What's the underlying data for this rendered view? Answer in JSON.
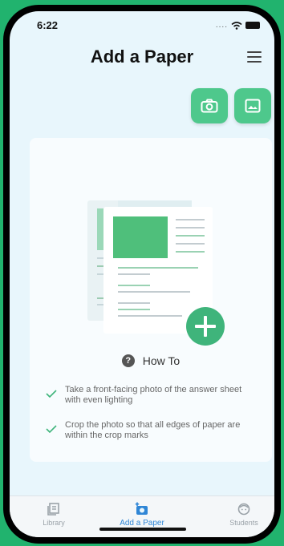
{
  "status_bar": {
    "time": "6:22",
    "signal": "...."
  },
  "header": {
    "title": "Add a Paper"
  },
  "icons": {
    "menu": "hamburger-menu-icon",
    "camera": "camera-icon",
    "gallery": "image-icon",
    "help": "question-circle-icon",
    "check": "check-icon",
    "add": "plus-icon"
  },
  "colors": {
    "accent": "#4ec88c",
    "background": "#e8f6fc",
    "outer": "#21b36e",
    "tab_active": "#2f86d6"
  },
  "howto": {
    "label": "How To",
    "tips": [
      "Take a front-facing photo of the answer sheet with even lighting",
      "Crop the photo so that all edges of paper are within the crop marks"
    ]
  },
  "tabs": [
    {
      "label": "Library",
      "icon": "library-icon",
      "active": false
    },
    {
      "label": "Add a Paper",
      "icon": "add-photo-icon",
      "active": true
    },
    {
      "label": "Students",
      "icon": "student-face-icon",
      "active": false
    }
  ]
}
